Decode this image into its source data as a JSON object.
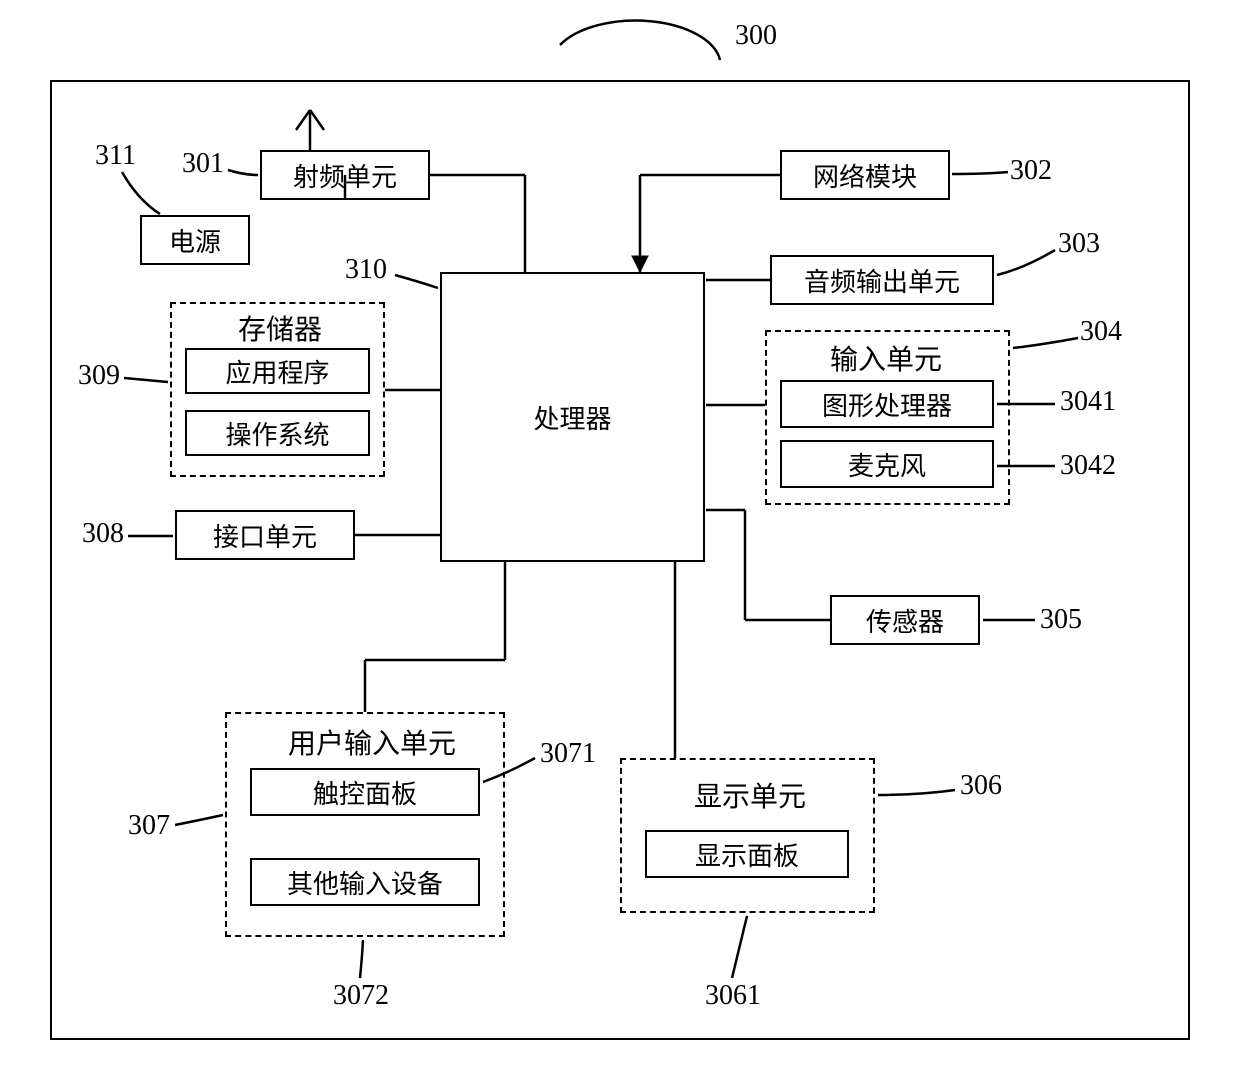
{
  "refs": {
    "frame": "300",
    "rf": "301",
    "net": "302",
    "audio": "303",
    "input_unit": "304",
    "gpu": "3041",
    "mic": "3042",
    "sensor": "305",
    "display_unit": "306",
    "display_panel": "3061",
    "user_input": "307",
    "touch": "3071",
    "other_input": "3072",
    "iface": "308",
    "memory": "309",
    "processor": "310",
    "power": "311"
  },
  "labels": {
    "rf": "射频单元",
    "net": "网络模块",
    "audio": "音频输出单元",
    "input_unit": "输入单元",
    "gpu": "图形处理器",
    "mic": "麦克风",
    "sensor": "传感器",
    "display_unit": "显示单元",
    "display_panel": "显示面板",
    "user_input": "用户输入单元",
    "touch": "触控面板",
    "other_input": "其他输入设备",
    "iface": "接口单元",
    "memory": "存储器",
    "app": "应用程序",
    "os": "操作系统",
    "processor": "处理器",
    "power": "电源"
  }
}
